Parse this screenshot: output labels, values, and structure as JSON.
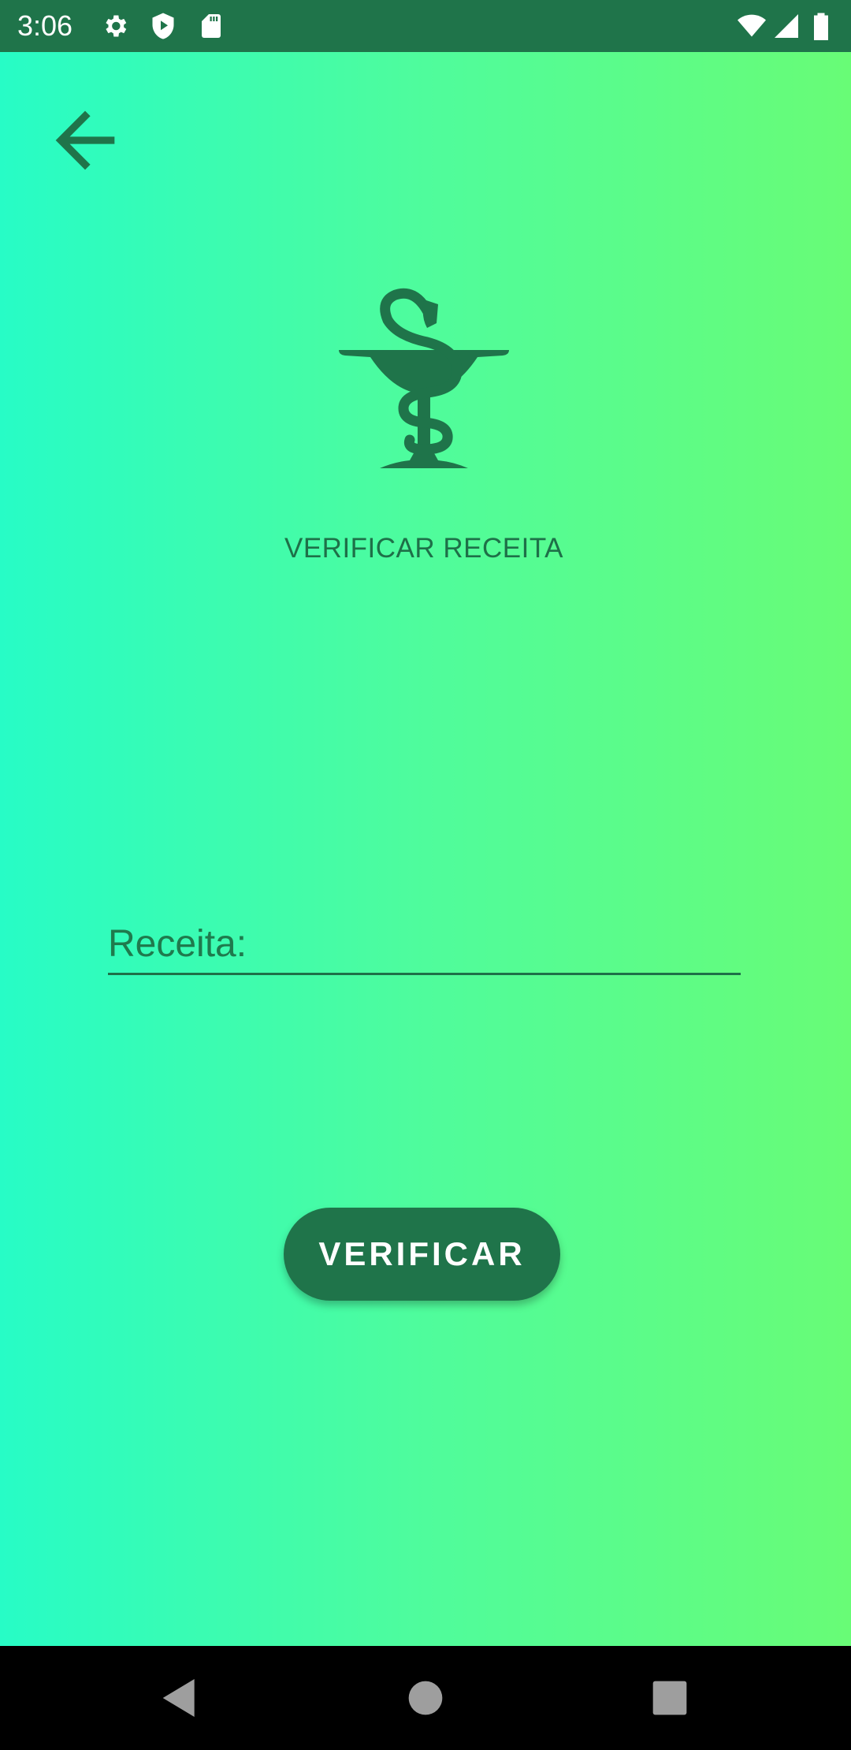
{
  "status_bar": {
    "time": "3:06",
    "left_icons": [
      "gear-icon",
      "shield-play-icon",
      "sd-card-icon"
    ],
    "right_icons": [
      "wifi-icon",
      "signal-icon",
      "battery-icon"
    ]
  },
  "toolbar": {
    "back_icon": "back-arrow-icon"
  },
  "logo": {
    "icon": "pharmacy-bowl-of-hygieia-icon"
  },
  "page": {
    "title": "VERIFICAR RECEITA"
  },
  "form": {
    "receita_placeholder": "Receita:",
    "receita_value": "",
    "verify_label": "VERIFICAR"
  },
  "nav_bar": {
    "back_icon": "triangle-back-icon",
    "home_icon": "circle-home-icon",
    "recents_icon": "square-recents-icon"
  },
  "colors": {
    "status_bar_bg": "#1f744a",
    "gradient_start": "#27fcc6",
    "gradient_end": "#68fc76",
    "primary_dark_green": "#1f744a",
    "nav_bar_bg": "#000000"
  }
}
